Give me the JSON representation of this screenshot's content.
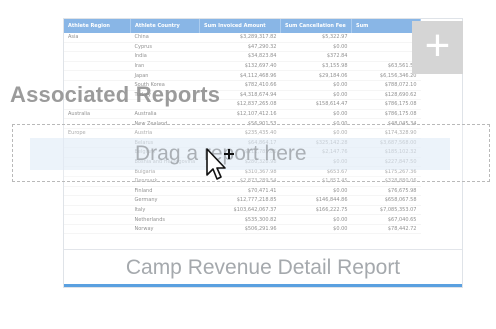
{
  "overlay": {
    "heading": "Associated Reports",
    "drop_text": "Drag a report here"
  },
  "card": {
    "title": "Camp Revenue Detail Report",
    "plus_label": "+",
    "table": {
      "headers": [
        "Athlete Region",
        "Athlete Country",
        "Sum Invoiced Amount",
        "Sum Cancellation Fee",
        "Sum"
      ],
      "rows": [
        [
          "Asia",
          "China",
          "$3,289,317.82",
          "$5,322.97",
          ""
        ],
        [
          "",
          "Cyprus",
          "$47,290.32",
          "$0.00",
          ""
        ],
        [
          "",
          "India",
          "$34,823.84",
          "$372.84",
          ""
        ],
        [
          "",
          "Iran",
          "$132,697.40",
          "$3,155.98",
          "$63,561.52"
        ],
        [
          "",
          "Japan",
          "$4,112,468.96",
          "$29,184.06",
          "$6,156,346.20"
        ],
        [
          "",
          "South Korea",
          "$782,410.66",
          "$0.00",
          "$788,072.10"
        ],
        [
          "",
          "Turkey",
          "$4,318,674.94",
          "$0.00",
          "$128,690.62"
        ],
        [
          "",
          "",
          "$12,837,265.08",
          "$158,614.47",
          "$786,175.08"
        ],
        [
          "Australia",
          "Australia",
          "$12,107,412.16",
          "$0.00",
          "$786,175.08"
        ],
        [
          "",
          "New Zealand",
          "$56,901.53",
          "$0.00",
          "$48,045.34"
        ],
        [
          "Europe",
          "Austria",
          "$235,435.40",
          "$0.00",
          "$174,328.90"
        ],
        [
          "",
          "Belarus",
          "$64,864.17",
          "$325,142.28",
          "$3,687,568.00"
        ],
        [
          "",
          "Belgium",
          "$112,785.86",
          "$2,147.76",
          "$185,102.32"
        ],
        [
          "",
          "Bosnia and Herzegovina",
          "$280,328.98",
          "$0.00",
          "$227,847.50"
        ],
        [
          "",
          "Bulgaria",
          "$310,367.98",
          "$653.67",
          "$175,267.36"
        ],
        [
          "",
          "Denmark",
          "$2,873,289.54",
          "$1,857.45",
          "$328,880.06"
        ],
        [
          "",
          "Finland",
          "$70,471.41",
          "$0.00",
          "$76,675.98"
        ],
        [
          "",
          "Germany",
          "$12,777,218.85",
          "$146,844.86",
          "$658,067.58"
        ],
        [
          "",
          "Italy",
          "$103,642,067.37",
          "$166,222.75",
          "$7,085,353.07"
        ],
        [
          "",
          "Netherlands",
          "$535,300.82",
          "$0.00",
          "$67,040.65"
        ],
        [
          "",
          "Norway",
          "$506,291.96",
          "$0.00",
          "$78,442.72"
        ]
      ]
    }
  }
}
